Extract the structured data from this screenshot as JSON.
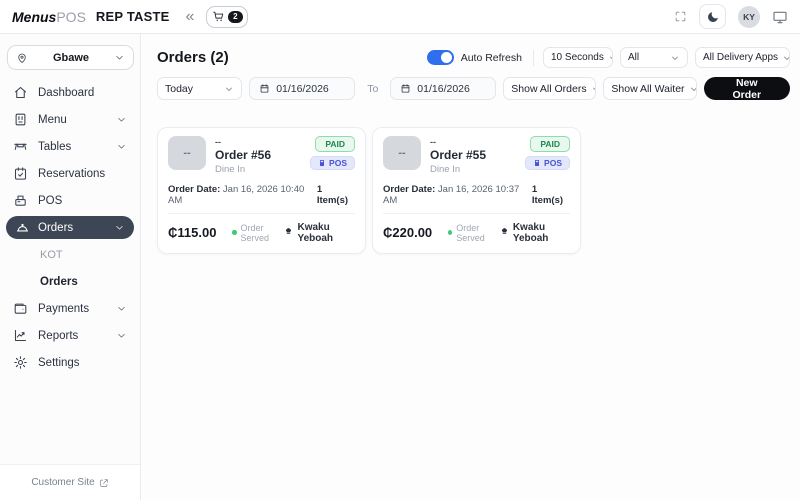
{
  "topbar": {
    "brand_bold": "Menus",
    "brand_light": "POS",
    "restaurant_name": "REP TASTE",
    "collapse_glyph": "«",
    "cart_count": "2",
    "avatar_initials": "KY"
  },
  "sidebar": {
    "location": "Gbawe",
    "items": [
      {
        "label": "Dashboard"
      },
      {
        "label": "Menu"
      },
      {
        "label": "Tables"
      },
      {
        "label": "Reservations"
      },
      {
        "label": "POS"
      },
      {
        "label": "Orders"
      },
      {
        "label": "Payments"
      },
      {
        "label": "Reports"
      },
      {
        "label": "Settings"
      }
    ],
    "sub_items": [
      {
        "label": "KOT"
      },
      {
        "label": "Orders"
      }
    ],
    "footer_link": "Customer Site"
  },
  "header": {
    "title": "Orders (2)",
    "auto_refresh_label": "Auto Refresh",
    "refresh_interval": "10 Seconds",
    "filter_all": "All",
    "delivery_apps": "All Delivery Apps"
  },
  "filters": {
    "date_preset": "Today",
    "date_from": "01/16/2026",
    "to_label": "To",
    "date_to": "01/16/2026",
    "orders_filter": "Show All Orders",
    "waiter_filter": "Show All Waiter",
    "new_order_label": "New Order"
  },
  "orders": [
    {
      "thumb_placeholder": "--",
      "table_placeholder": "--",
      "number": "Order #56",
      "type": "Dine In",
      "paid_badge": "PAID",
      "source_badge": "POS",
      "date_label": "Order Date:",
      "date": "Jan 16, 2026 10:40 AM",
      "items": "1 Item(s)",
      "total": "₵115.00",
      "status": "Order Served",
      "waiter": "Kwaku Yeboah"
    },
    {
      "thumb_placeholder": "--",
      "table_placeholder": "--",
      "number": "Order #55",
      "type": "Dine In",
      "paid_badge": "PAID",
      "source_badge": "POS",
      "date_label": "Order Date:",
      "date": "Jan 16, 2026 10:37 AM",
      "items": "1 Item(s)",
      "total": "₵220.00",
      "status": "Order Served",
      "waiter": "Kwaku Yeboah"
    }
  ],
  "colors": {
    "accent_blue": "#2f6fed",
    "paid_green": "#1d8a4b",
    "pos_indigo": "#4a52d8",
    "active_nav_bg": "#3d4654",
    "new_order_black": "#0c0e12",
    "status_green": "#3ec878"
  }
}
